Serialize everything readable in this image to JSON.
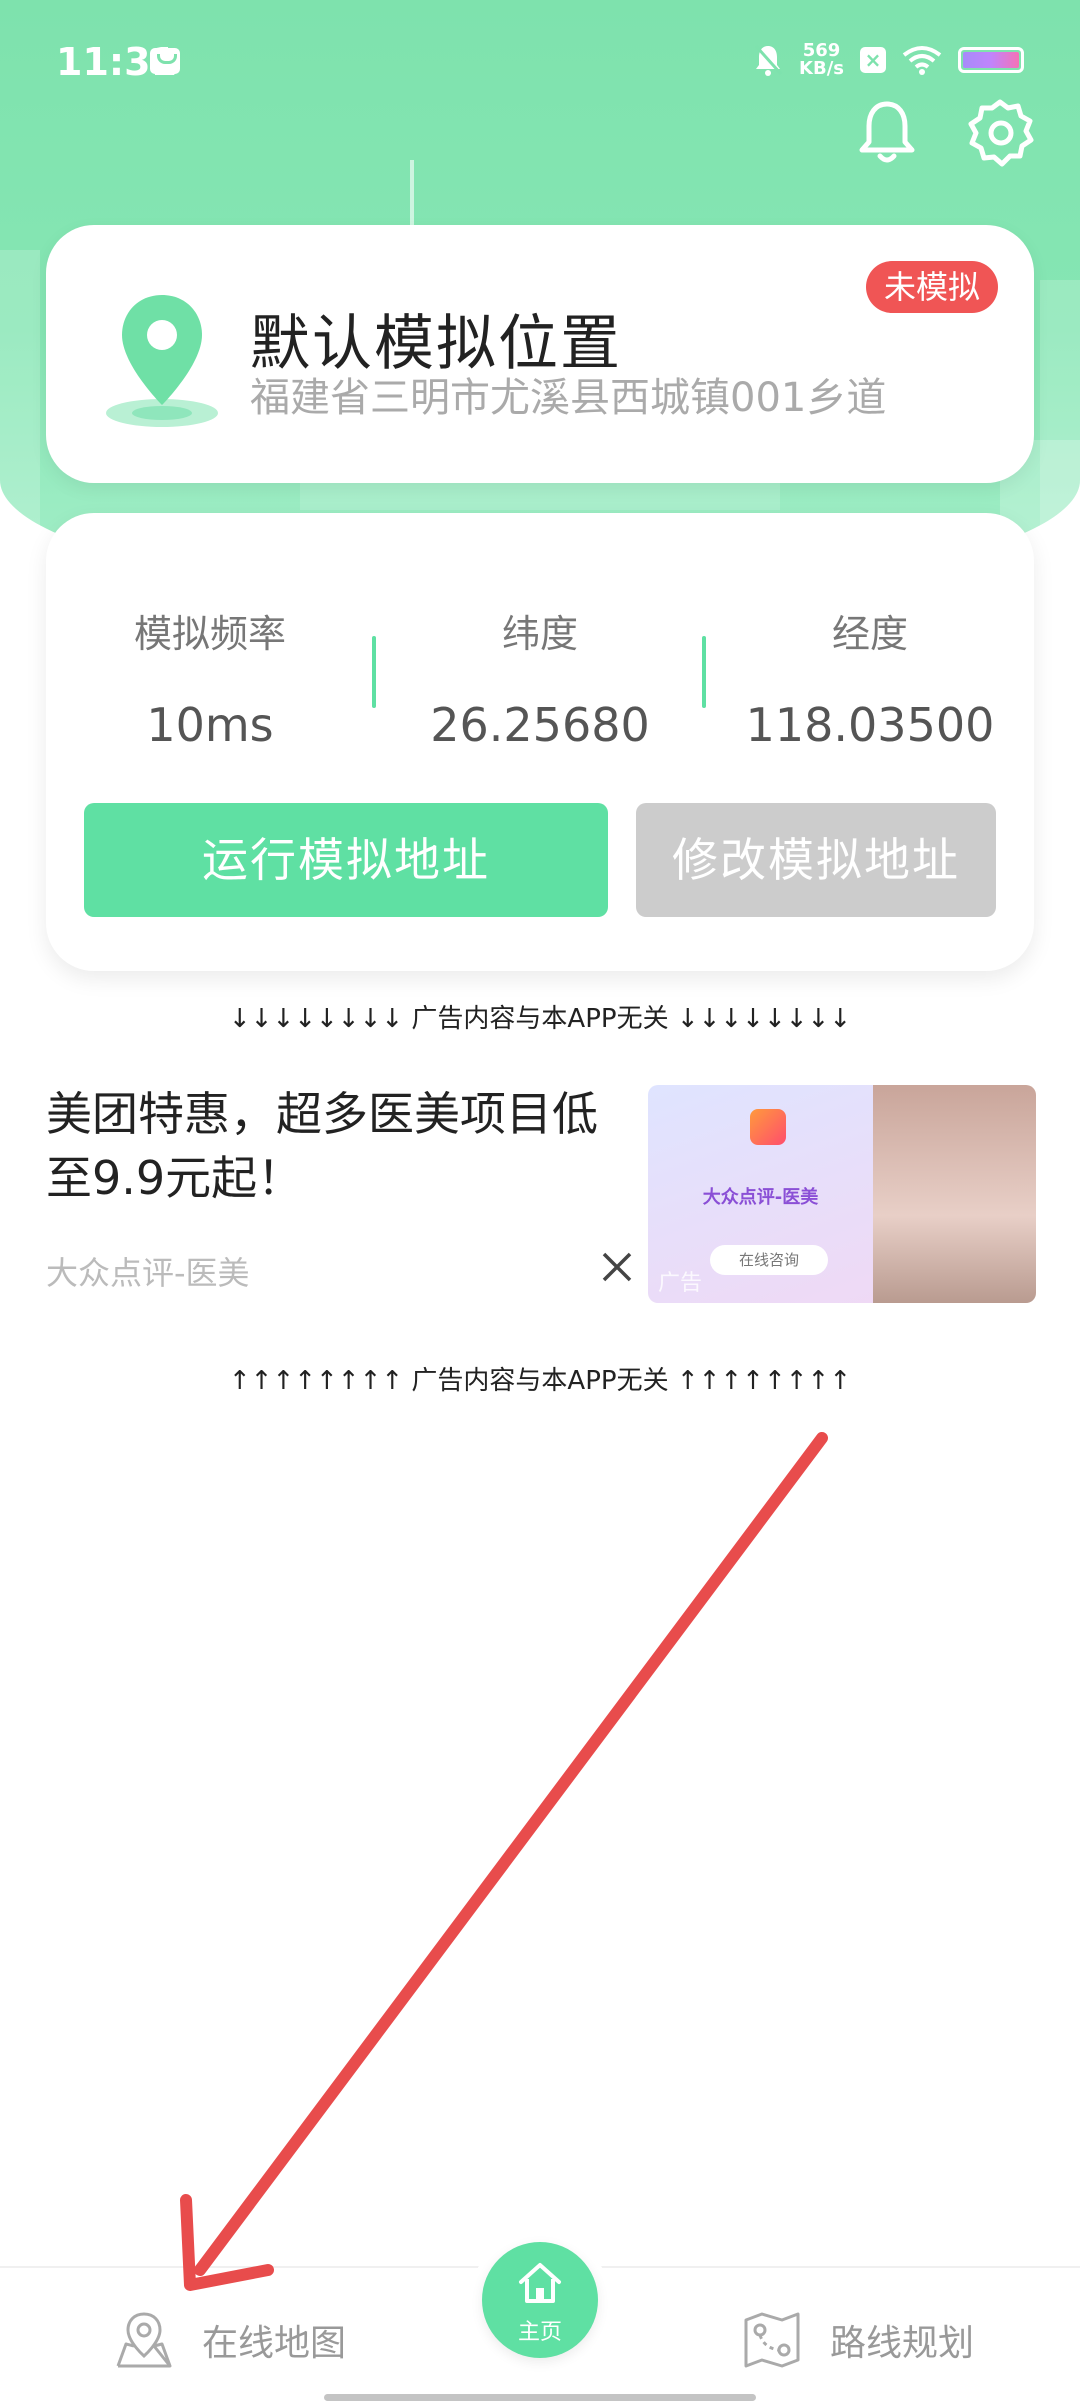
{
  "status_bar": {
    "time": "11:31",
    "net_speed_value": "569",
    "net_speed_unit": "KB/s"
  },
  "location": {
    "title": "默认模拟位置",
    "address": "福建省三明市尤溪县西城镇001乡道",
    "badge": "未模拟"
  },
  "stats": {
    "frequency_label": "模拟频率",
    "frequency_value": "10ms",
    "latitude_label": "纬度",
    "latitude_value": "26.25680",
    "longitude_label": "经度",
    "longitude_value": "118.03500"
  },
  "actions": {
    "run_label": "运行模拟地址",
    "edit_label": "修改模拟地址"
  },
  "ad": {
    "notice_top": "↓↓↓↓↓↓↓↓ 广告内容与本APP无关 ↓↓↓↓↓↓↓↓",
    "notice_bottom": "↑↑↑↑↑↑↑↑ 广告内容与本APP无关 ↑↑↑↑↑↑↑↑",
    "title": "美团特惠，超多医美项目低至9.9元起！",
    "source": "大众点评-医美",
    "image_brand": "大众点评-医美",
    "image_cta": "在线咨询",
    "image_mark": "广告"
  },
  "nav": {
    "map_label": "在线地图",
    "home_label": "主页",
    "route_label": "路线规划"
  },
  "colors": {
    "accent": "#5fe0a3",
    "badge": "#f05555",
    "arrow": "#e84c4c"
  }
}
